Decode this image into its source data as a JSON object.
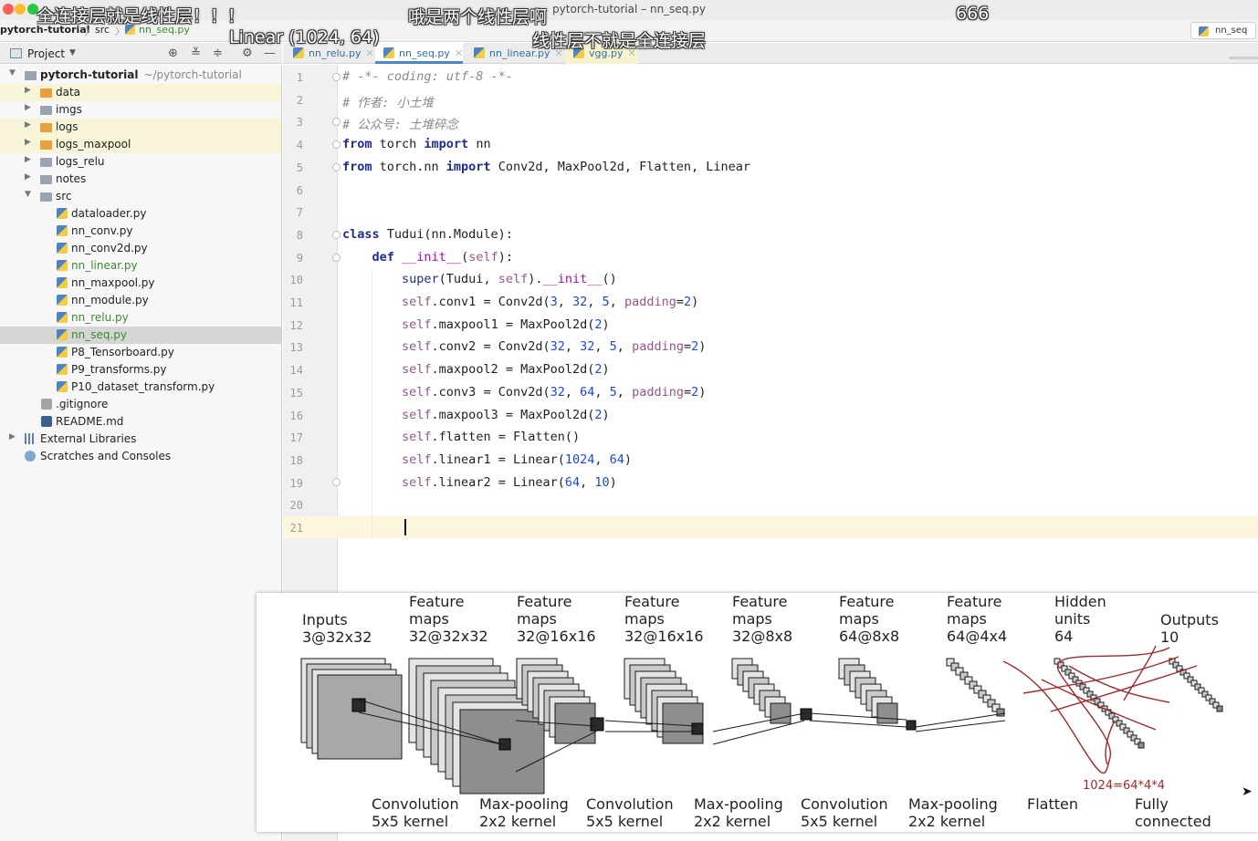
{
  "window": {
    "title": "pytorch-tutorial – nn_seq.py"
  },
  "navbar": {
    "project": "pytorch-tutorial",
    "folder": "src",
    "file": "nn_seq.py",
    "run_config": "nn_seq"
  },
  "project_panel": {
    "title": "Project"
  },
  "tabs": [
    {
      "label": "nn_relu.py",
      "active": false
    },
    {
      "label": "nn_seq.py",
      "active": true
    },
    {
      "label": "nn_linear.py",
      "active": false
    },
    {
      "label": "vgg.py",
      "active": false
    }
  ],
  "tree": [
    {
      "label": "pytorch-tutorial",
      "hint": "~/pytorch-tutorial"
    },
    {
      "label": "data"
    },
    {
      "label": "imgs"
    },
    {
      "label": "logs"
    },
    {
      "label": "logs_maxpool"
    },
    {
      "label": "logs_relu"
    },
    {
      "label": "notes"
    },
    {
      "label": "src"
    },
    {
      "label": "dataloader.py"
    },
    {
      "label": "nn_conv.py"
    },
    {
      "label": "nn_conv2d.py"
    },
    {
      "label": "nn_linear.py"
    },
    {
      "label": "nn_maxpool.py"
    },
    {
      "label": "nn_module.py"
    },
    {
      "label": "nn_relu.py"
    },
    {
      "label": "nn_seq.py"
    },
    {
      "label": "P8_Tensorboard.py"
    },
    {
      "label": "P9_transforms.py"
    },
    {
      "label": "P10_dataset_transform.py"
    },
    {
      "label": ".gitignore"
    },
    {
      "label": "README.md"
    },
    {
      "label": "External Libraries"
    },
    {
      "label": "Scratches and Consoles"
    }
  ],
  "editor": {
    "line_numbers": [
      "1",
      "2",
      "3",
      "4",
      "5",
      "6",
      "7",
      "8",
      "9",
      "10",
      "11",
      "12",
      "13",
      "14",
      "15",
      "16",
      "17",
      "18",
      "19",
      "20",
      "21"
    ],
    "lines": [
      [
        {
          "t": "# -*- coding: utf-8 -*-",
          "c": "comment"
        }
      ],
      [
        {
          "t": "# 作者: 小土堆",
          "c": "comment"
        }
      ],
      [
        {
          "t": "# 公众号: 土堆碎念",
          "c": "comment"
        }
      ],
      [
        {
          "t": "from",
          "c": "kw"
        },
        {
          "t": " torch ",
          "c": ""
        },
        {
          "t": "import",
          "c": "kw"
        },
        {
          "t": " nn",
          "c": ""
        }
      ],
      [
        {
          "t": "from",
          "c": "kw"
        },
        {
          "t": " torch.nn ",
          "c": ""
        },
        {
          "t": "import",
          "c": "kw"
        },
        {
          "t": " Conv2d, MaxPool2d, Flatten, Linear",
          "c": ""
        }
      ],
      [],
      [],
      [
        {
          "t": "class",
          "c": "kw"
        },
        {
          "t": " Tudui(nn.Module):",
          "c": ""
        }
      ],
      [
        {
          "t": "    ",
          "c": ""
        },
        {
          "t": "def",
          "c": "kw"
        },
        {
          "t": " ",
          "c": ""
        },
        {
          "t": "__init__",
          "c": "fn"
        },
        {
          "t": "(",
          "c": ""
        },
        {
          "t": "self",
          "c": "self"
        },
        {
          "t": "):",
          "c": ""
        }
      ],
      [
        {
          "t": "        ",
          "c": ""
        },
        {
          "t": "super",
          "c": "builtin"
        },
        {
          "t": "(Tudui, ",
          "c": ""
        },
        {
          "t": "self",
          "c": "self"
        },
        {
          "t": ").",
          "c": ""
        },
        {
          "t": "__init__",
          "c": "magic"
        },
        {
          "t": "()",
          "c": ""
        }
      ],
      [
        {
          "t": "        ",
          "c": ""
        },
        {
          "t": "self",
          "c": "self"
        },
        {
          "t": ".conv1 = Conv2d(",
          "c": ""
        },
        {
          "t": "3",
          "c": "num"
        },
        {
          "t": ", ",
          "c": ""
        },
        {
          "t": "32",
          "c": "num"
        },
        {
          "t": ", ",
          "c": ""
        },
        {
          "t": "5",
          "c": "num"
        },
        {
          "t": ", ",
          "c": ""
        },
        {
          "t": "padding",
          "c": "self"
        },
        {
          "t": "=",
          "c": ""
        },
        {
          "t": "2",
          "c": "num"
        },
        {
          "t": ")",
          "c": ""
        }
      ],
      [
        {
          "t": "        ",
          "c": ""
        },
        {
          "t": "self",
          "c": "self"
        },
        {
          "t": ".maxpool1 = MaxPool2d(",
          "c": ""
        },
        {
          "t": "2",
          "c": "num"
        },
        {
          "t": ")",
          "c": ""
        }
      ],
      [
        {
          "t": "        ",
          "c": ""
        },
        {
          "t": "self",
          "c": "self"
        },
        {
          "t": ".conv2 = Conv2d(",
          "c": ""
        },
        {
          "t": "32",
          "c": "num"
        },
        {
          "t": ", ",
          "c": ""
        },
        {
          "t": "32",
          "c": "num"
        },
        {
          "t": ", ",
          "c": ""
        },
        {
          "t": "5",
          "c": "num"
        },
        {
          "t": ", ",
          "c": ""
        },
        {
          "t": "padding",
          "c": "self"
        },
        {
          "t": "=",
          "c": ""
        },
        {
          "t": "2",
          "c": "num"
        },
        {
          "t": ")",
          "c": ""
        }
      ],
      [
        {
          "t": "        ",
          "c": ""
        },
        {
          "t": "self",
          "c": "self"
        },
        {
          "t": ".maxpool2 = MaxPool2d(",
          "c": ""
        },
        {
          "t": "2",
          "c": "num"
        },
        {
          "t": ")",
          "c": ""
        }
      ],
      [
        {
          "t": "        ",
          "c": ""
        },
        {
          "t": "self",
          "c": "self"
        },
        {
          "t": ".conv3 = Conv2d(",
          "c": ""
        },
        {
          "t": "32",
          "c": "num"
        },
        {
          "t": ", ",
          "c": ""
        },
        {
          "t": "64",
          "c": "num"
        },
        {
          "t": ", ",
          "c": ""
        },
        {
          "t": "5",
          "c": "num"
        },
        {
          "t": ", ",
          "c": ""
        },
        {
          "t": "padding",
          "c": "self"
        },
        {
          "t": "=",
          "c": ""
        },
        {
          "t": "2",
          "c": "num"
        },
        {
          "t": ")",
          "c": ""
        }
      ],
      [
        {
          "t": "        ",
          "c": ""
        },
        {
          "t": "self",
          "c": "self"
        },
        {
          "t": ".maxpool3 = MaxPool2d(",
          "c": ""
        },
        {
          "t": "2",
          "c": "num"
        },
        {
          "t": ")",
          "c": ""
        }
      ],
      [
        {
          "t": "        ",
          "c": ""
        },
        {
          "t": "self",
          "c": "self"
        },
        {
          "t": ".flatten = Flatten()",
          "c": ""
        }
      ],
      [
        {
          "t": "        ",
          "c": ""
        },
        {
          "t": "self",
          "c": "self"
        },
        {
          "t": ".linear1 = Linear(",
          "c": ""
        },
        {
          "t": "1024",
          "c": "num"
        },
        {
          "t": ", ",
          "c": ""
        },
        {
          "t": "64",
          "c": "num"
        },
        {
          "t": ")",
          "c": ""
        }
      ],
      [
        {
          "t": "        ",
          "c": ""
        },
        {
          "t": "self",
          "c": "self"
        },
        {
          "t": ".linear2 = Linear(",
          "c": ""
        },
        {
          "t": "64",
          "c": "num"
        },
        {
          "t": ", ",
          "c": ""
        },
        {
          "t": "10",
          "c": "num"
        },
        {
          "t": ")",
          "c": ""
        }
      ],
      [],
      []
    ]
  },
  "subtitles": {
    "s1": "全连接层就是线性层！！！",
    "s2": "哦是两个线性层啊",
    "s3": "666",
    "s4": "Linear (1024,  64)",
    "s5": "线性层不就是全连接层"
  },
  "diagram": {
    "top_labels": [
      [
        "Inputs",
        "3@32x32"
      ],
      [
        "Feature",
        "maps",
        "32@32x32"
      ],
      [
        "Feature",
        "maps",
        "32@16x16"
      ],
      [
        "Feature",
        "maps",
        "32@16x16"
      ],
      [
        "Feature",
        "maps",
        "32@8x8"
      ],
      [
        "Feature",
        "maps",
        "64@8x8"
      ],
      [
        "Feature",
        "maps",
        "64@4x4"
      ],
      [
        "Hidden",
        "units",
        "64"
      ],
      [
        "Outputs",
        "10"
      ]
    ],
    "bottom_labels": [
      [
        "Convolution",
        "5x5 kernel"
      ],
      [
        "Max-pooling",
        "2x2 kernel"
      ],
      [
        "Convolution",
        "5x5 kernel"
      ],
      [
        "Max-pooling",
        "2x2 kernel"
      ],
      [
        "Convolution",
        "5x5 kernel"
      ],
      [
        "Max-pooling",
        "2x2 kernel"
      ],
      [
        "Flatten"
      ],
      [
        "Fully",
        "connected"
      ]
    ],
    "annotation": "1024=64*4*4",
    "annotation_color": "#a3262b"
  },
  "colors": {
    "accent": "#4a88c7",
    "highlight_row": "#f7f4d8",
    "caret_line": "#fbf6dc"
  }
}
